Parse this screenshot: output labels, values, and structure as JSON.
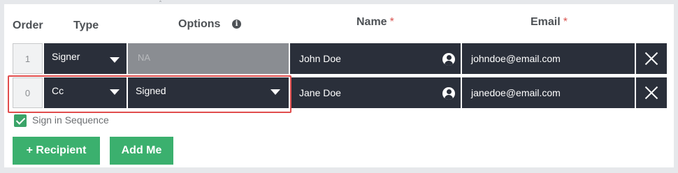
{
  "headers": {
    "order": "Order",
    "type": "Type",
    "options": "Options",
    "name": "Name",
    "email": "Email",
    "required_mark": "*"
  },
  "info_glyph": "i",
  "recipients": [
    {
      "order": "1",
      "type": "Signer",
      "option": "NA",
      "option_disabled": true,
      "name": "John Doe",
      "email": "johndoe@email.com"
    },
    {
      "order": "0",
      "type": "Cc",
      "option": "Signed",
      "option_disabled": false,
      "name": "Jane Doe",
      "email": "janedoe@email.com"
    }
  ],
  "sign_in_sequence": {
    "label": "Sign in Sequence",
    "checked": true
  },
  "buttons": {
    "add_recipient": "+ Recipient",
    "add_me": "Add Me"
  },
  "colors": {
    "dark_field": "#2a2f3a",
    "accent_green": "#3bb06e",
    "highlight_red": "#e14d4d",
    "disabled_field": "#8a8d92"
  },
  "icons": [
    "info-icon",
    "chevron-down-icon",
    "user-icon",
    "close-icon",
    "checkmark-icon"
  ]
}
